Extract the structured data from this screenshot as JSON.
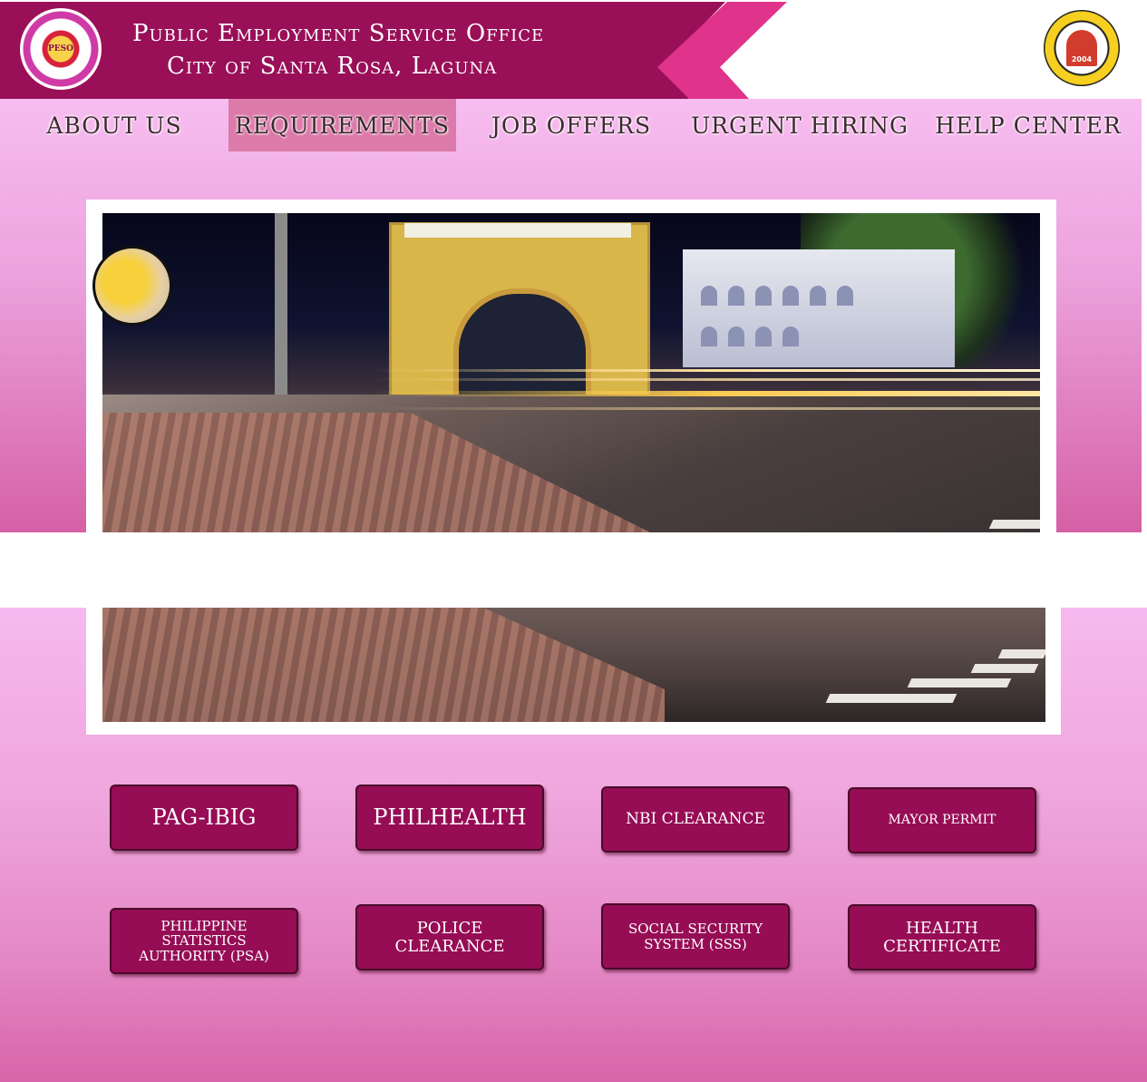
{
  "header": {
    "title_line1": "Public Employment Service Office",
    "title_line2": "City of Santa Rosa, Laguna",
    "logo_left_icon": "peso-city-seal-icon",
    "logo_left_text": "PESO",
    "logo_right_icon": "santa-rosa-city-seal-icon",
    "logo_right_text": "2004",
    "brand_color": "#990f58",
    "accent_color": "#e0338c"
  },
  "nav": {
    "items": [
      {
        "label": "ABOUT US"
      },
      {
        "label": "REQUIREMENTS",
        "active": true
      },
      {
        "label": "JOB OFFERS"
      },
      {
        "label": "URGENT HIRING"
      },
      {
        "label": "HELP CENTER"
      }
    ]
  },
  "hero": {
    "image": "santa-rosa-arch-night-street-photo"
  },
  "requirements": {
    "buttons": [
      {
        "label": "PAG-IBIG"
      },
      {
        "label": "PHILHEALTH"
      },
      {
        "label": "NBI CLEARANCE"
      },
      {
        "label": "MAYOR PERMIT"
      },
      {
        "label": "PHILIPPINE STATISTICS AUTHORITY (PSA)"
      },
      {
        "label": "POLICE CLEARANCE"
      },
      {
        "label": "SOCIAL SECURITY SYSTEM (SSS)"
      },
      {
        "label": "HEALTH CERTIFICATE"
      }
    ],
    "button_color": "#960d55"
  }
}
